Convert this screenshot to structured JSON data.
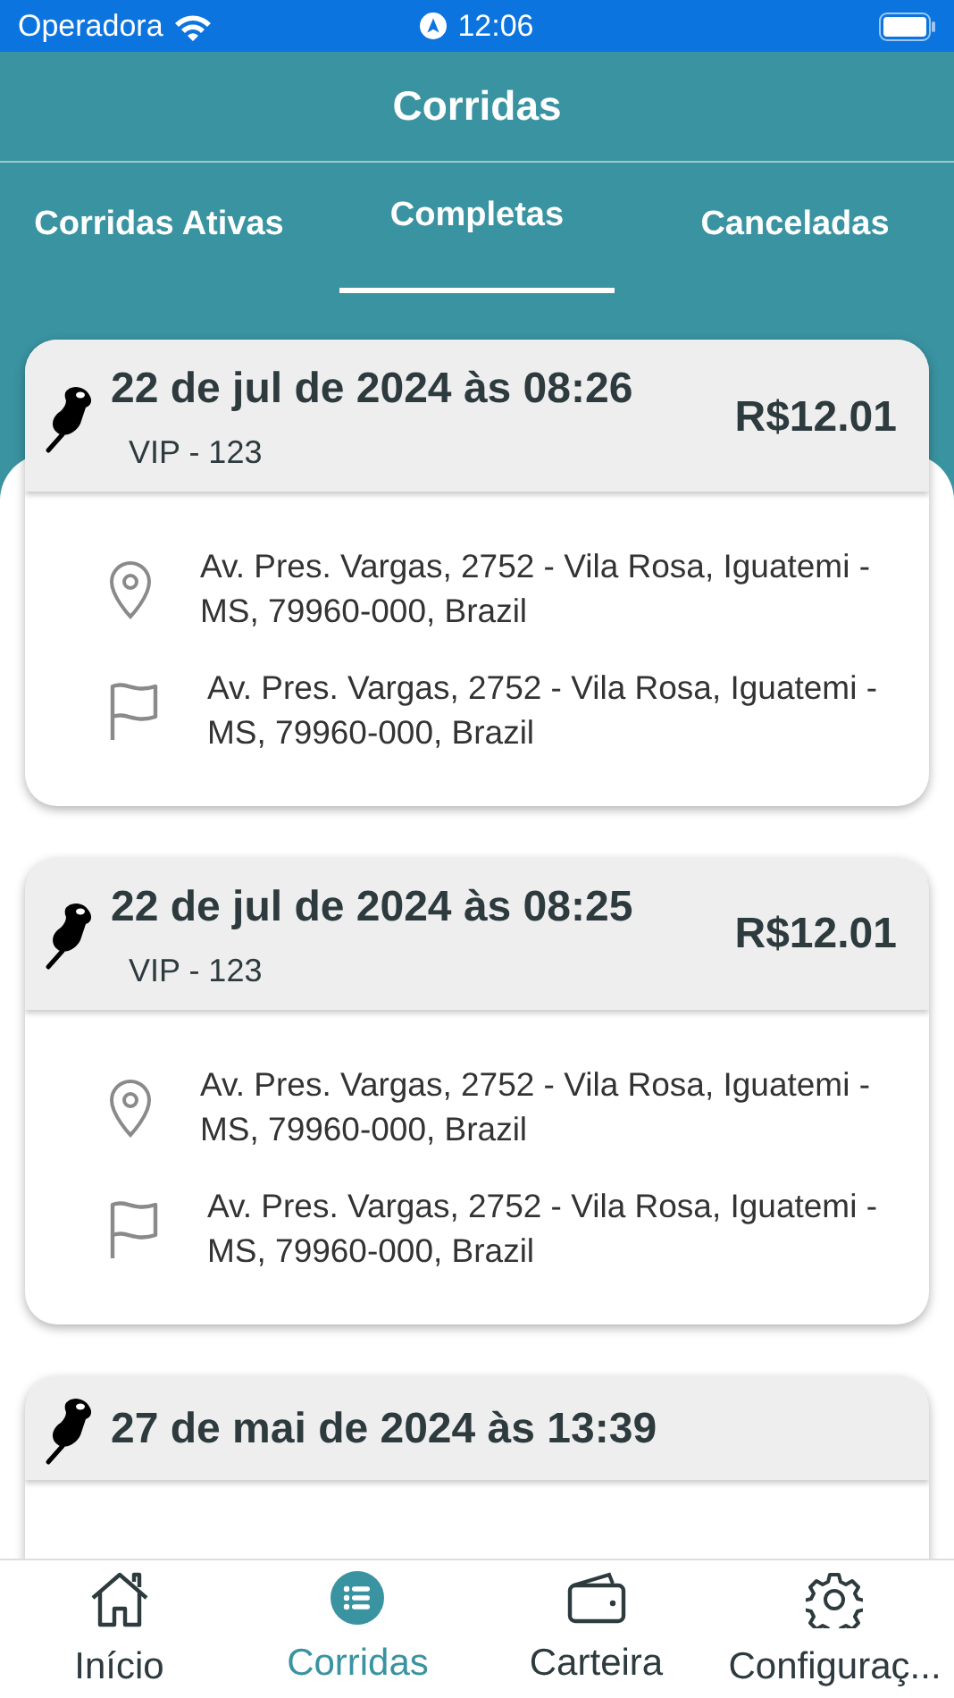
{
  "status_bar": {
    "carrier": "Operadora",
    "time": "12:06"
  },
  "header": {
    "title": "Corridas"
  },
  "tabs": [
    {
      "label": "Corridas Ativas",
      "selected": false
    },
    {
      "label": "Completas",
      "selected": true
    },
    {
      "label": "Canceladas",
      "selected": false
    }
  ],
  "rides": [
    {
      "date": "22 de jul de 2024 às 08:26",
      "vehicle": "VIP - 123",
      "price": "R$12.01",
      "origin": "Av. Pres. Vargas, 2752 - Vila Rosa, Iguatemi - MS, 79960-000, Brazil",
      "destination": "Av. Pres. Vargas, 2752 - Vila Rosa, Iguatemi - MS, 79960-000, Brazil"
    },
    {
      "date": "22 de jul de 2024 às 08:25",
      "vehicle": "VIP - 123",
      "price": "R$12.01",
      "origin": "Av. Pres. Vargas, 2752 - Vila Rosa, Iguatemi - MS, 79960-000, Brazil",
      "destination": "Av. Pres. Vargas, 2752 - Vila Rosa, Iguatemi - MS, 79960-000, Brazil"
    },
    {
      "date": "27 de mai de 2024 às 13:39"
    }
  ],
  "bottom_nav": [
    {
      "kind": "home",
      "label": "Início",
      "selected": false
    },
    {
      "kind": "list",
      "label": "Corridas",
      "selected": true
    },
    {
      "kind": "wallet",
      "label": "Carteira",
      "selected": false
    },
    {
      "kind": "settings",
      "label": "Configuraç...",
      "selected": false
    }
  ]
}
